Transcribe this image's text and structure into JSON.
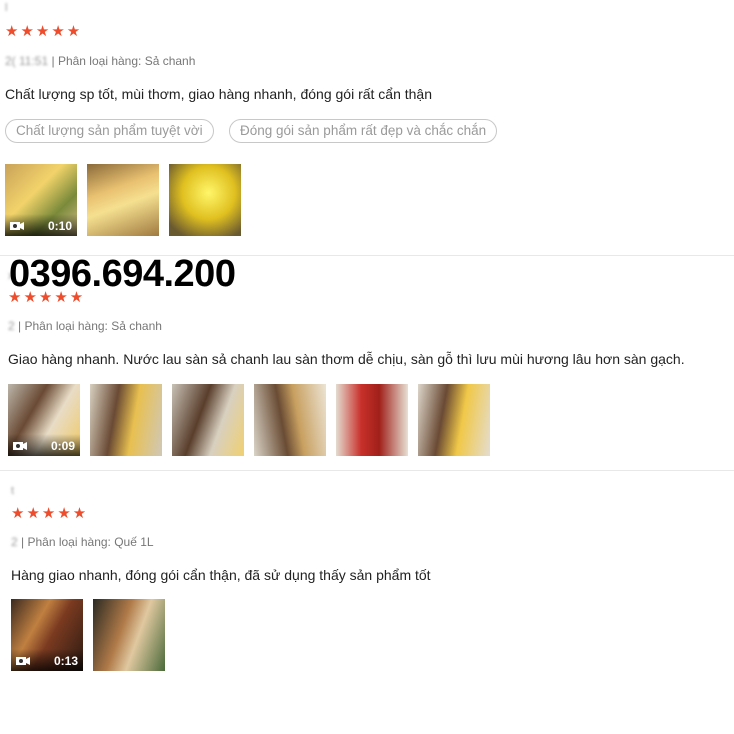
{
  "overlay": {
    "phone_number": "0396.694.200"
  },
  "reviews": [
    {
      "username": "l",
      "stars": "★★★★★",
      "date": "2(    11:51",
      "variation": "| Phân loại hàng: Sả chanh",
      "comment": "Chất lượng sp tốt, mùi thơm, giao hàng nhanh, đóng gói rất cẩn thận",
      "tags": [
        "Chất lượng sản phẩm tuyệt vời",
        "Đóng gói sản phẩm rất đẹp và chắc chắn"
      ],
      "video_duration": "0:10"
    },
    {
      "username": "x",
      "stars": "★★★★★",
      "date": "2",
      "variation": "| Phân loại hàng: Sả chanh",
      "comment": "Giao hàng nhanh. Nước lau sàn sả chanh lau sàn thơm dễ chịu, sàn gỗ thì lưu mùi hương lâu hơn sàn gạch.",
      "video_duration": "0:09"
    },
    {
      "username": "t",
      "stars": "★★★★★",
      "date": "2",
      "variation": "| Phân loại hàng: Quế 1L",
      "comment": "Hàng giao nhanh, đóng gói cẩn thận, đã sử dụng thấy sản phẩm tốt",
      "video_duration": "0:13"
    }
  ],
  "colors": {
    "star": "#ee4d2d",
    "tag_border": "#c8c8c8",
    "divider": "#e8e8e8"
  }
}
